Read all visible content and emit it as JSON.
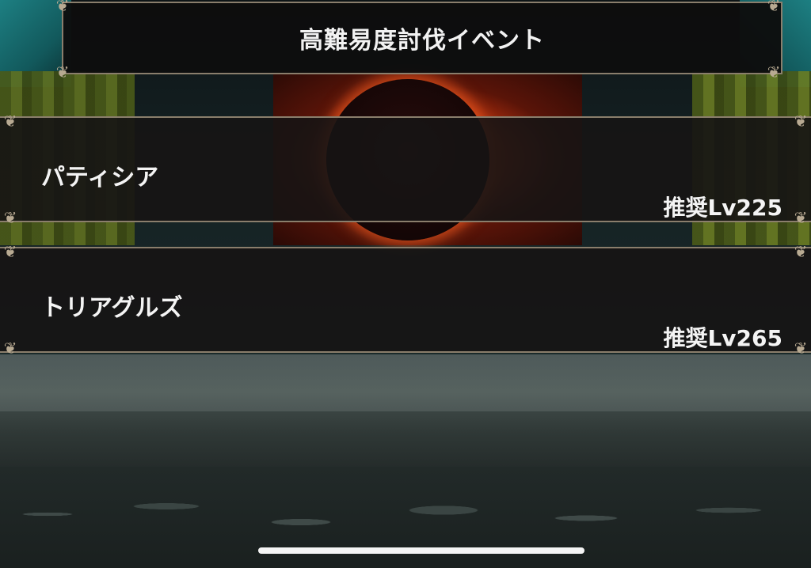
{
  "header": {
    "title": "高難易度討伐イベント"
  },
  "events": [
    {
      "name": "パティシア",
      "level": "推奨Lv225"
    },
    {
      "name": "トリアグルズ",
      "level": "推奨Lv265"
    }
  ],
  "colors": {
    "frame": "#8a7e6c",
    "panel": "#161414",
    "text": "#f4f4f4",
    "eclipse_glow": "#ff5a14"
  },
  "icons": {
    "ornament": "ornate-corner-icon"
  }
}
